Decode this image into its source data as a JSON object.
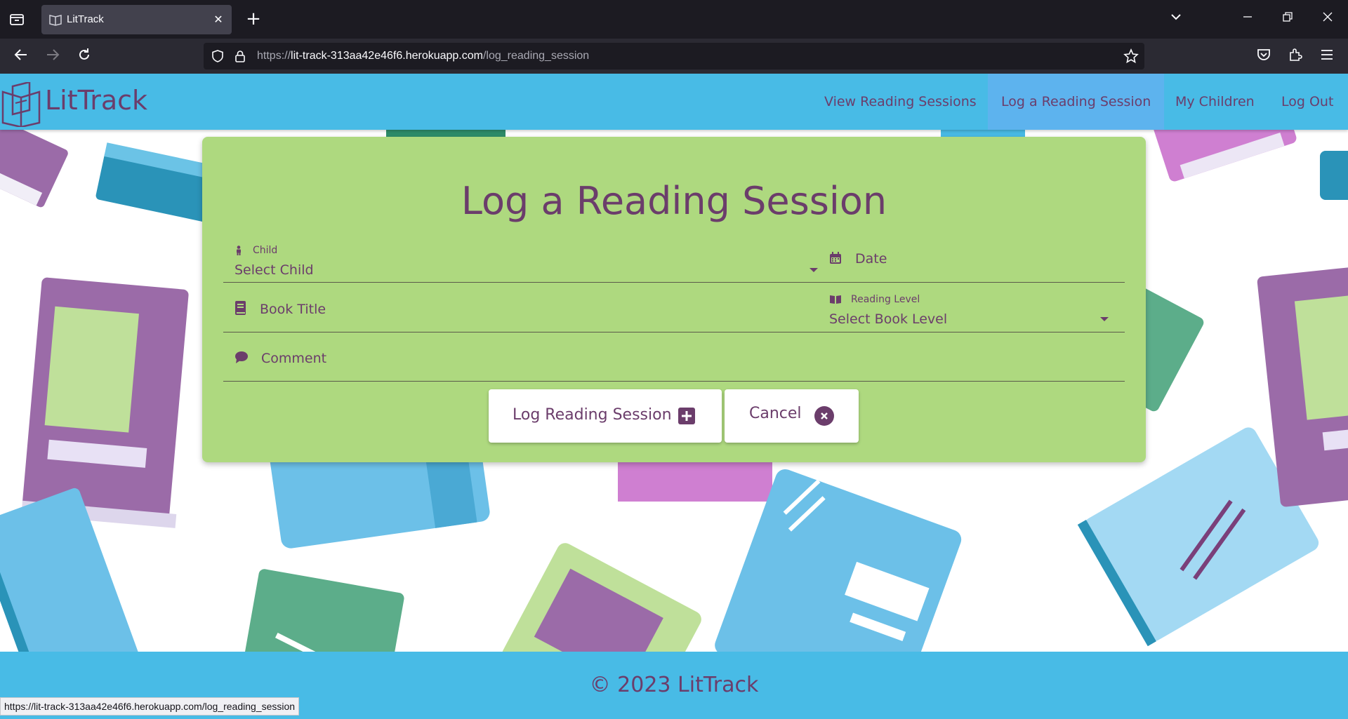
{
  "browser": {
    "tab_title": "LitTrack",
    "url_prefix": "https://",
    "url_host": "lit-track-313aa42e46f6.herokuapp.com",
    "url_path": "/log_reading_session",
    "status_url": "https://lit-track-313aa42e46f6.herokuapp.com/log_reading_session"
  },
  "site": {
    "logo_text": "LitTrack",
    "nav": [
      {
        "label": "View Reading Sessions"
      },
      {
        "label": "Log a Reading Session"
      },
      {
        "label": "My Children"
      },
      {
        "label": "Log Out"
      }
    ],
    "footer": "© 2023 LitTrack"
  },
  "form": {
    "title": "Log a Reading Session",
    "child": {
      "label": "Child",
      "placeholder": "Select Child"
    },
    "date": {
      "label": "Date"
    },
    "book_title": {
      "label": "Book Title"
    },
    "reading_level": {
      "label": "Reading Level",
      "placeholder": "Select Book Level"
    },
    "comment": {
      "label": "Comment"
    },
    "submit_label": "Log Reading Session",
    "cancel_label": "Cancel"
  },
  "colors": {
    "header": "#48bbe6",
    "nav_active": "#5db3ee",
    "card": "#aed97f",
    "text": "#6b3d6b"
  }
}
